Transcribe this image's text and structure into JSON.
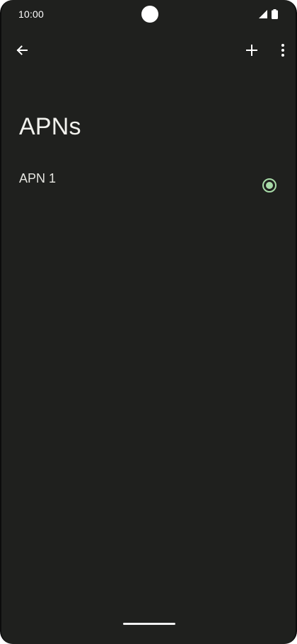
{
  "status_bar": {
    "time": "10:00"
  },
  "app_bar": {
    "back_icon": "arrow-left-icon",
    "add_icon": "plus-icon",
    "overflow_icon": "more-vertical-icon"
  },
  "page": {
    "title": "APNs"
  },
  "apns": [
    {
      "label": "APN 1",
      "selected": true
    }
  ],
  "colors": {
    "background": "#1f201e",
    "text_primary": "#f1f1ed",
    "accent_radio": "#a8dba8"
  }
}
